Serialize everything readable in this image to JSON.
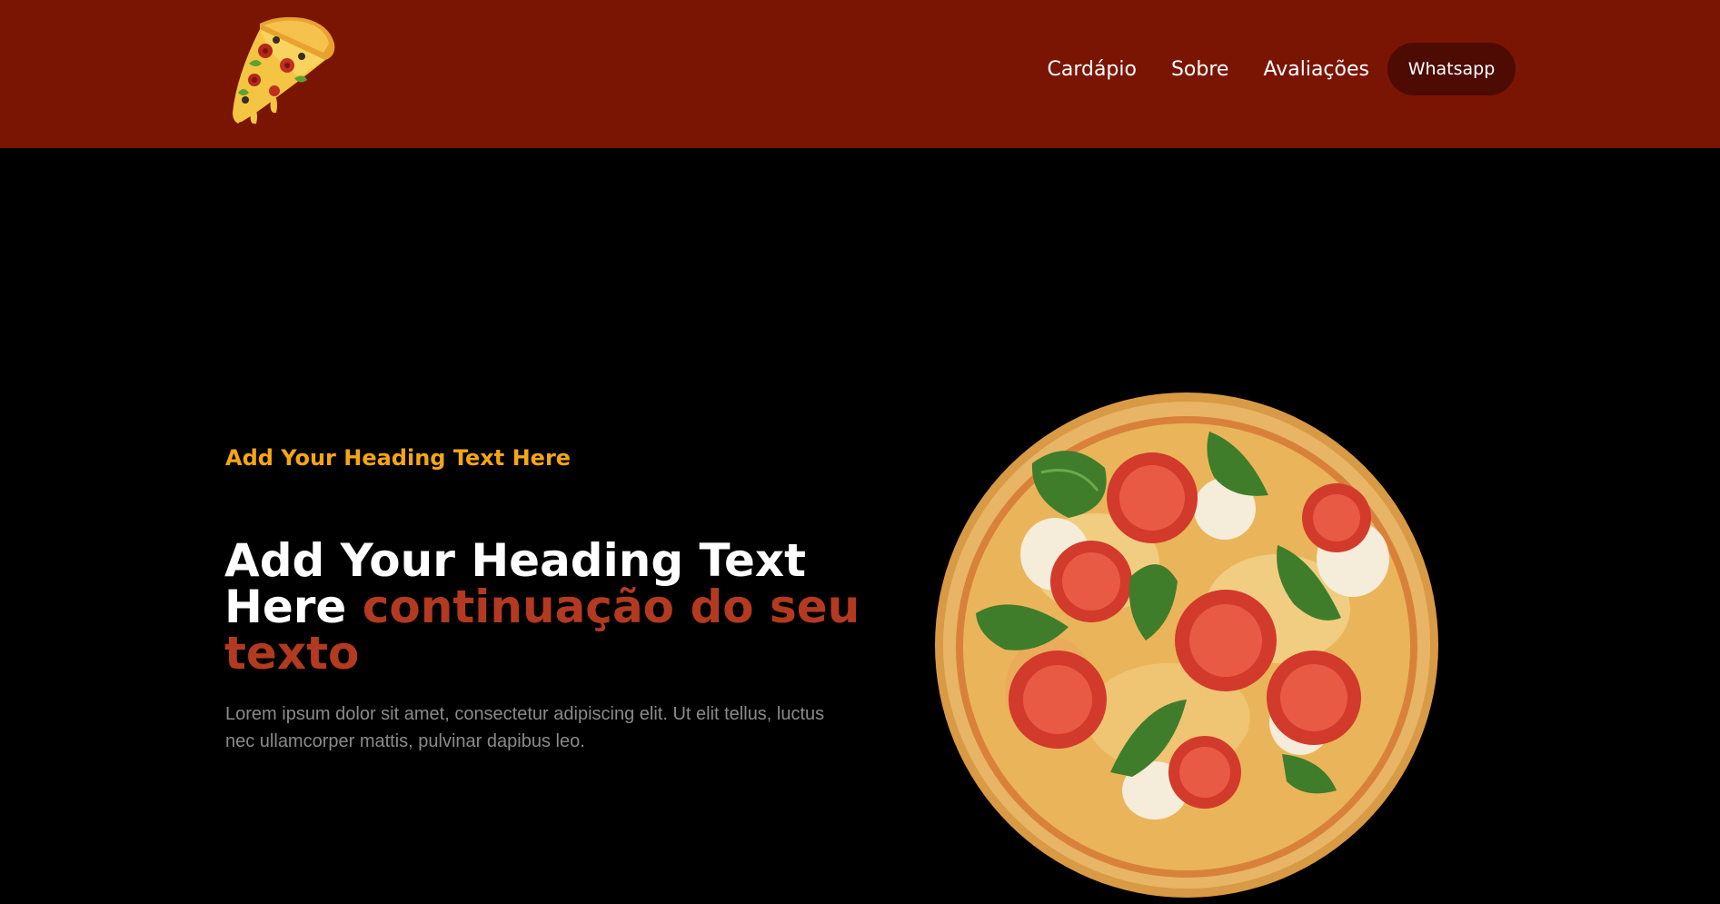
{
  "header": {
    "logo": "pizza-slice-logo",
    "nav": [
      {
        "label": "Cardápio"
      },
      {
        "label": "Sobre"
      },
      {
        "label": "Avaliações"
      }
    ],
    "cta_label": "Whatsapp"
  },
  "hero": {
    "kicker": "Add Your Heading Text Here",
    "title_main": "Add Your Heading Text Here",
    "title_accent": "continuação do seu texto",
    "body": "Lorem ipsum dolor sit amet, consectetur adipiscing elit. Ut elit tellus, luctus nec ullamcorper mattis, pulvinar dapibus leo.",
    "image": "pizza-image"
  },
  "colors": {
    "header_bg": "#7b1503",
    "page_bg": "#000000",
    "button_bg": "#4d0b04",
    "kicker": "#f5a614",
    "accent": "#b33a20",
    "body_text": "#8a8a8a"
  }
}
